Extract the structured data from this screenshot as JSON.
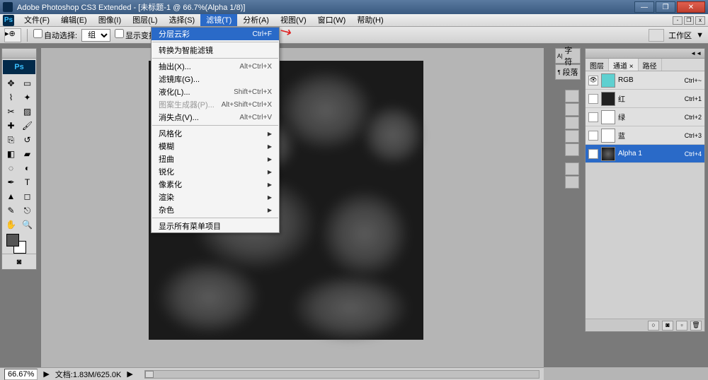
{
  "title": "Adobe Photoshop CS3 Extended - [未标题-1 @ 66.7%(Alpha 1/8)]",
  "menus": [
    "文件(F)",
    "编辑(E)",
    "图像(I)",
    "图层(L)",
    "选择(S)",
    "滤镜(T)",
    "分析(A)",
    "视图(V)",
    "窗口(W)",
    "帮助(H)"
  ],
  "menu_active_index": 5,
  "options": {
    "autoselect_label": "自动选择:",
    "autoselect_value": "组",
    "show_transform_label": "显示变换",
    "workspace_label": "工作区"
  },
  "dropdown": {
    "items": [
      {
        "label": "分层云彩",
        "shortcut": "Ctrl+F",
        "hi": true
      },
      {
        "sep": true
      },
      {
        "label": "转换为智能滤镜"
      },
      {
        "sep": true
      },
      {
        "label": "抽出(X)...",
        "shortcut": "Alt+Ctrl+X"
      },
      {
        "label": "滤镜库(G)..."
      },
      {
        "label": "液化(L)...",
        "shortcut": "Shift+Ctrl+X"
      },
      {
        "label": "图案生成器(P)...",
        "shortcut": "Alt+Shift+Ctrl+X",
        "dis": true
      },
      {
        "label": "消失点(V)...",
        "shortcut": "Alt+Ctrl+V"
      },
      {
        "sep": true
      },
      {
        "label": "风格化",
        "sub": true
      },
      {
        "label": "模糊",
        "sub": true
      },
      {
        "label": "扭曲",
        "sub": true
      },
      {
        "label": "锐化",
        "sub": true
      },
      {
        "label": "像素化",
        "sub": true
      },
      {
        "label": "渲染",
        "sub": true
      },
      {
        "label": "杂色",
        "sub": true
      },
      {
        "sep": true
      },
      {
        "label": "显示所有菜单项目"
      }
    ]
  },
  "side_tabs": {
    "char": "字符",
    "para": "段落"
  },
  "channels_panel": {
    "tabs": [
      "图层",
      "通道",
      "路径"
    ],
    "active_tab": 1,
    "tab_close": "通道 ×",
    "channels": [
      {
        "name": "RGB",
        "shortcut": "Ctrl+~",
        "color": "#5fd0d0",
        "sel": false
      },
      {
        "name": "红",
        "shortcut": "Ctrl+1",
        "color": "#202020",
        "sel": false
      },
      {
        "name": "绿",
        "shortcut": "Ctrl+2",
        "color": "#ffffff",
        "sel": false
      },
      {
        "name": "蓝",
        "shortcut": "Ctrl+3",
        "color": "#ffffff",
        "sel": false
      },
      {
        "name": "Alpha 1",
        "shortcut": "Ctrl+4",
        "color": "clouds",
        "sel": true
      }
    ]
  },
  "status": {
    "zoom": "66.67%",
    "doc": "文档:1.83M/625.0K"
  },
  "ps_logo": "Ps"
}
